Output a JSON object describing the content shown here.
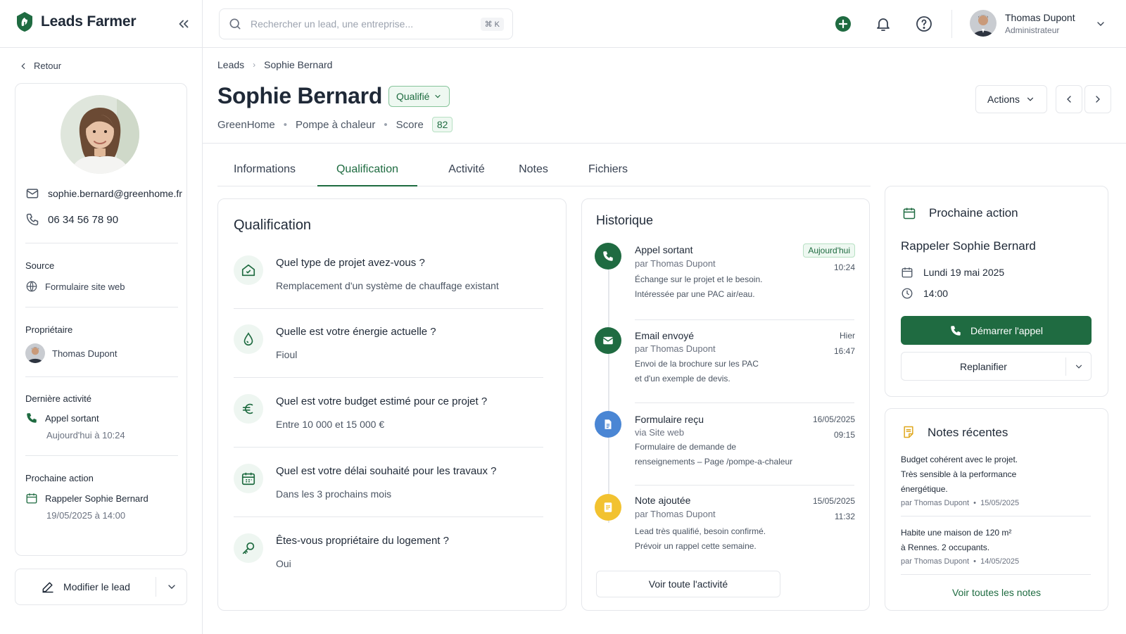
{
  "brand": {
    "name": "Leads Farmer"
  },
  "search": {
    "placeholder": "Rechercher un lead, une entreprise...",
    "shortcut": "⌘ K"
  },
  "user": {
    "name": "Thomas Dupont",
    "role": "Administrateur"
  },
  "sidebar": {
    "back_label": "Retour",
    "email": "sophie.bernard@greenhome.fr",
    "phone": "06 34 56 78 90",
    "source": {
      "label": "Source",
      "value": "Formulaire site web"
    },
    "owner": {
      "label": "Propriétaire",
      "value": "Thomas Dupont"
    },
    "last_activity": {
      "label": "Dernière activité",
      "value": "Appel sortant",
      "time": "Aujourd'hui à 10:24"
    },
    "next_action": {
      "label": "Prochaine action",
      "value": "Rappeler Sophie Bernard",
      "time": "19/05/2025 à 14:00"
    },
    "edit_label": "Modifier le lead"
  },
  "header": {
    "breadcrumb": [
      "Leads",
      "Sophie Bernard"
    ],
    "title": "Sophie Bernard",
    "status": "Qualifié",
    "company": "GreenHome",
    "product": "Pompe à chaleur",
    "score_label": "Score",
    "score": "82",
    "actions_label": "Actions"
  },
  "tabs": [
    "Informations",
    "Qualification",
    "Activité",
    "Notes",
    "Fichiers"
  ],
  "qualification": {
    "title": "Qualification",
    "items": [
      {
        "icon": "home-icon",
        "question": "Quel type de projet avez-vous ?",
        "answer": "Remplacement d'un système de chauffage existant"
      },
      {
        "icon": "drop-icon",
        "question": "Quelle est votre énergie actuelle ?",
        "answer": "Fioul"
      },
      {
        "icon": "euro-icon",
        "question": "Quel est votre budget estimé pour ce projet ?",
        "answer": "Entre 10 000 et 15 000 €"
      },
      {
        "icon": "calendar-icon",
        "question": "Quel est votre délai souhaité pour les travaux ?",
        "answer": "Dans les 3 prochains mois"
      },
      {
        "icon": "key-icon",
        "question": "Êtes-vous propriétaire du logement ?",
        "answer": "Oui"
      }
    ]
  },
  "history": {
    "title": "Historique",
    "items": [
      {
        "icon": "phone-icon",
        "color": "#1f6b41",
        "title": "Appel sortant",
        "by": "par Thomas Dupont",
        "badge": "Aujourd'hui",
        "date": "",
        "time": "10:24",
        "desc": [
          "Échange sur le projet et le besoin.",
          "Intéressée par une PAC air/eau."
        ]
      },
      {
        "icon": "mail-icon",
        "color": "#1f6b41",
        "title": "Email envoyé",
        "by": "par Thomas Dupont",
        "badge": "",
        "date": "Hier",
        "time": "16:47",
        "desc": [
          "Envoi de la brochure sur les PAC",
          "et d'un exemple de devis."
        ]
      },
      {
        "icon": "document-icon",
        "color": "#4a86d4",
        "title": "Formulaire reçu",
        "by": "via Site web",
        "badge": "",
        "date": "16/05/2025",
        "time": "09:15",
        "desc": [
          "Formulaire de demande de",
          "renseignements – Page /pompe-a-chaleur"
        ]
      },
      {
        "icon": "note-icon",
        "color": "#f2c230",
        "title": "Note ajoutée",
        "by": "par Thomas Dupont",
        "badge": "",
        "date": "15/05/2025",
        "time": "11:32",
        "desc": [
          "Lead très qualifié, besoin confirmé.",
          "Prévoir un rappel cette semaine."
        ]
      }
    ],
    "see_all": "Voir toute l'activité"
  },
  "next_action": {
    "title": "Prochaine action",
    "lead": "Rappeler Sophie Bernard",
    "date": "Lundi 19 mai 2025",
    "time": "14:00",
    "start_label": "Démarrer l'appel",
    "replan_label": "Replanifier"
  },
  "notes": {
    "title": "Notes récentes",
    "items": [
      {
        "lines": [
          "Budget cohérent avec le projet.",
          "Très sensible à la performance",
          "énergétique."
        ],
        "author": "par Thomas Dupont",
        "date": "15/05/2025"
      },
      {
        "lines": [
          "Habite une maison de 120 m²",
          "à Rennes. 2 occupants."
        ],
        "author": "par Thomas Dupont",
        "date": "14/05/2025"
      }
    ],
    "see_all": "Voir toutes les notes"
  },
  "colors": {
    "accent": "#1f6b41",
    "accent_light": "#eef8f1",
    "blue": "#4a86d4",
    "yellow": "#f2c230"
  }
}
